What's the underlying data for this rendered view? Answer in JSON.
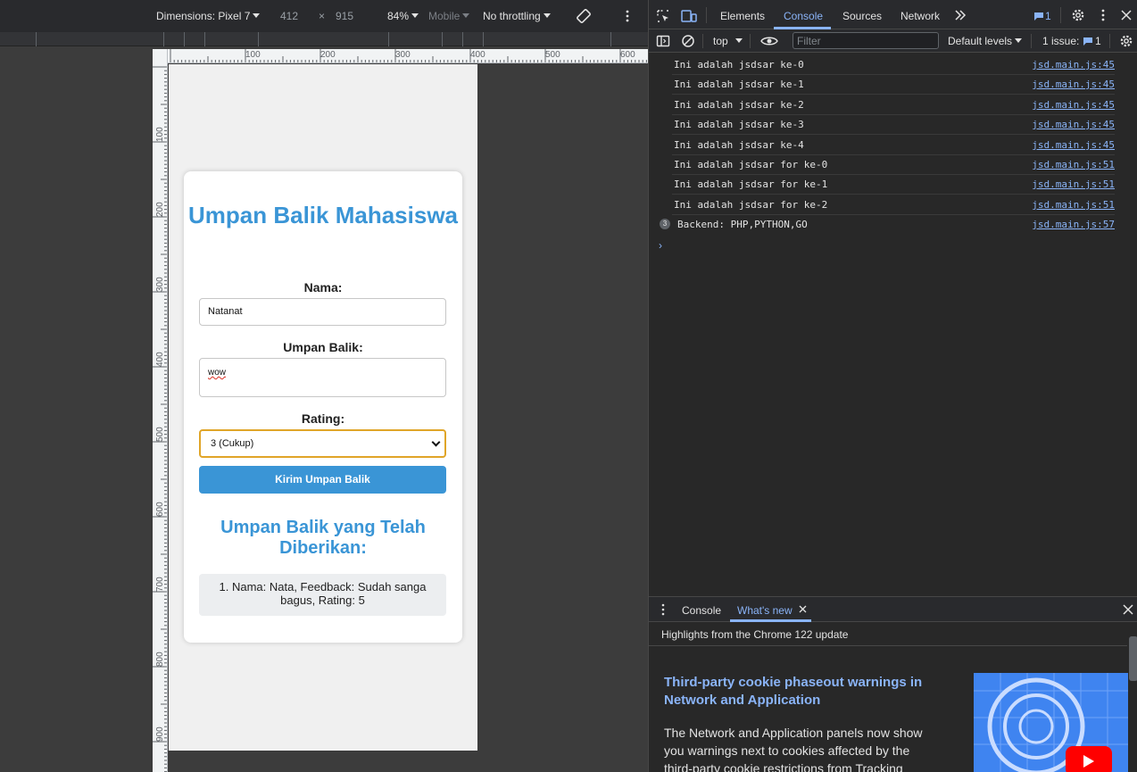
{
  "device_toolbar": {
    "dimensions_label": "Dimensions: Pixel 7",
    "width": "412",
    "times": "×",
    "height": "915",
    "zoom": "84%",
    "device_type": "Mobile",
    "throttling": "No throttling"
  },
  "ruler": {
    "h_labels": [
      "100",
      "200",
      "300",
      "400",
      "500",
      "600"
    ],
    "v_labels": [
      "100",
      "200",
      "300",
      "400",
      "500",
      "600",
      "700",
      "800",
      "900"
    ]
  },
  "page": {
    "title": "Umpan Balik Mahasiswa",
    "name_label": "Nama:",
    "name_value": "Natanat",
    "feedback_label": "Umpan Balik:",
    "feedback_value": "wow",
    "rating_label": "Rating:",
    "rating_selected": "3 (Cukup)",
    "submit_label": "Kirim Umpan Balik",
    "list_title": "Umpan Balik yang Telah Diberikan:",
    "items": [
      "1. Nama: Nata, Feedback: Sudah sanga bagus, Rating: 5"
    ]
  },
  "devtools": {
    "tabs": [
      "Elements",
      "Console",
      "Sources",
      "Network"
    ],
    "active_tab": "Console",
    "issue_count": "1",
    "context": "top",
    "filter_placeholder": "Filter",
    "levels": "Default levels",
    "issues_label": "1 issue:",
    "issues_count": "1",
    "logs": [
      {
        "msg": "Ini adalah jsdsar ke-0",
        "src": "jsd.main.js:45"
      },
      {
        "msg": "Ini adalah jsdsar ke-1",
        "src": "jsd.main.js:45"
      },
      {
        "msg": "Ini adalah jsdsar ke-2",
        "src": "jsd.main.js:45"
      },
      {
        "msg": "Ini adalah jsdsar ke-3",
        "src": "jsd.main.js:45"
      },
      {
        "msg": "Ini adalah jsdsar ke-4",
        "src": "jsd.main.js:45"
      },
      {
        "msg": "Ini adalah jsdsar for ke-0",
        "src": "jsd.main.js:51"
      },
      {
        "msg": "Ini adalah jsdsar for ke-1",
        "src": "jsd.main.js:51"
      },
      {
        "msg": "Ini adalah jsdsar for ke-2",
        "src": "jsd.main.js:51"
      },
      {
        "msg": "Backend: PHP,PYTHON,GO",
        "src": "jsd.main.js:57",
        "count": "3"
      }
    ],
    "prompt": "›",
    "drawer": {
      "tabs": [
        "Console",
        "What's new"
      ],
      "active_tab": "What's new",
      "highlights": "Highlights from the Chrome 122 update",
      "news_title": "Third-party cookie phaseout warnings in Network and Application",
      "news_body": "The Network and Application panels now show you warnings next to cookies affected by the third-party cookie restrictions from Tracking"
    }
  },
  "colors": {
    "accent": "#3a95d6",
    "devtools_link": "#8ab4f8",
    "select_focus": "#e0a528"
  }
}
